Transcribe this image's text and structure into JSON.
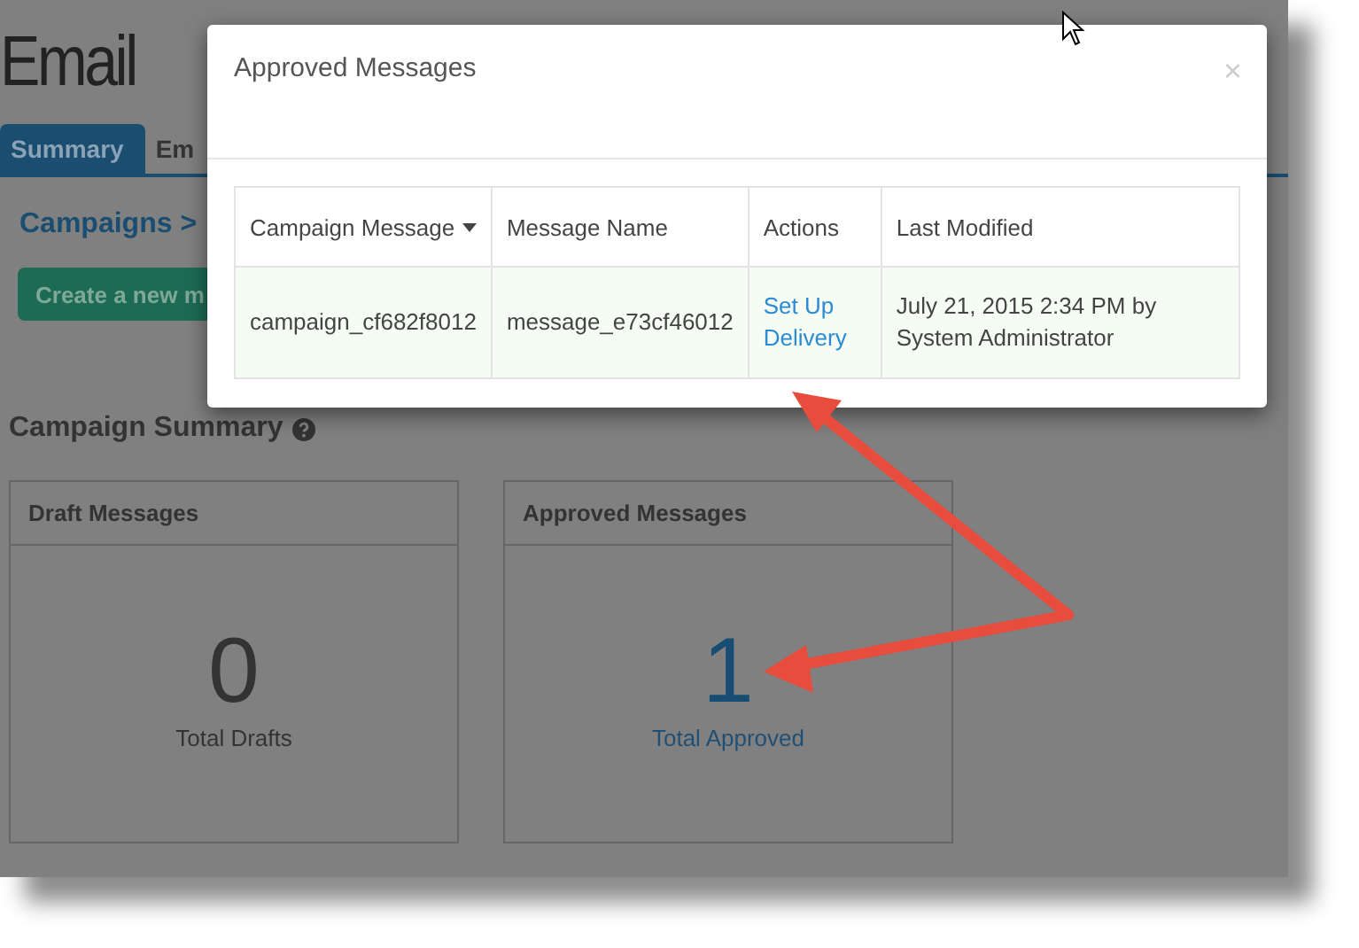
{
  "page": {
    "title": "Email",
    "tabs": [
      {
        "label": "Summary",
        "selected": true
      },
      {
        "label": "Em",
        "selected": false
      }
    ],
    "breadcrumb": "Campaigns >",
    "create_button": "Create a new m",
    "section_title": "Campaign Summary",
    "cards": [
      {
        "title": "Draft Messages",
        "count": "0",
        "caption": "Total Drafts",
        "kind": "neutral"
      },
      {
        "title": "Approved Messages",
        "count": "1",
        "caption": "Total Approved",
        "kind": "accent"
      }
    ]
  },
  "modal": {
    "title": "Approved Messages",
    "close": "×",
    "table": {
      "columns": [
        {
          "label": "Campaign Message",
          "sorted": true
        },
        {
          "label": "Message Name",
          "sorted": false
        },
        {
          "label": "Actions",
          "sorted": false
        },
        {
          "label": "Last Modified",
          "sorted": false
        }
      ],
      "rows": [
        {
          "cells": [
            {
              "text": "campaign_cf682f8012",
              "kind": "text"
            },
            {
              "text": "message_e73cf46012",
              "kind": "text"
            },
            {
              "text": "Set Up Delivery",
              "kind": "link"
            },
            {
              "text": "July 21, 2015 2:34 PM by System Administrator",
              "kind": "text"
            }
          ]
        }
      ]
    }
  }
}
